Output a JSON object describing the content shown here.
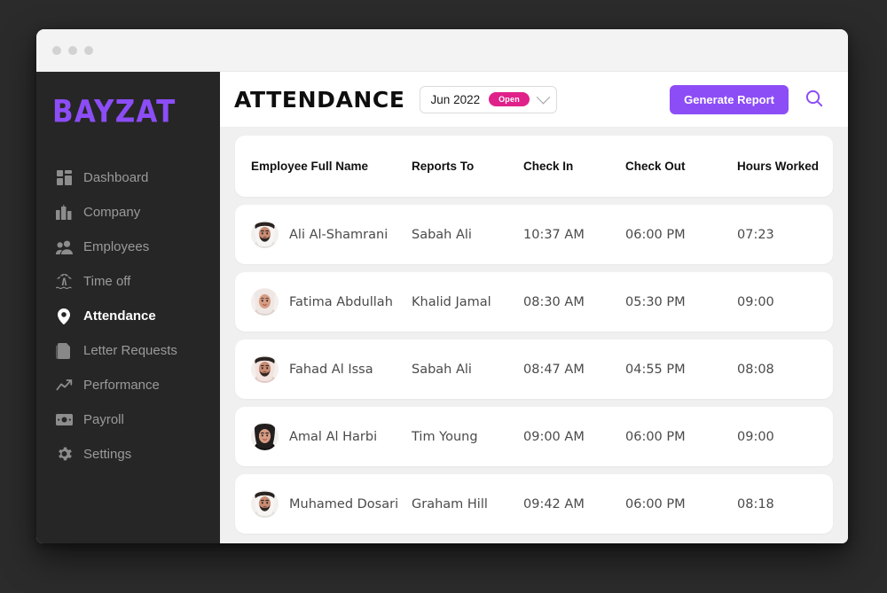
{
  "window": {
    "traffic_lights": [
      "dot",
      "dot",
      "dot"
    ]
  },
  "brand": {
    "logo_text": "BAYZAT",
    "logo_color": "#8c4df7"
  },
  "sidebar": {
    "items": [
      {
        "label": "Dashboard",
        "icon": "grid-icon",
        "active": false
      },
      {
        "label": "Company",
        "icon": "buildings-icon",
        "active": false
      },
      {
        "label": "Employees",
        "icon": "people-icon",
        "active": false
      },
      {
        "label": "Time off",
        "icon": "palm-tree-icon",
        "active": false
      },
      {
        "label": "Attendance",
        "icon": "location-pin-icon",
        "active": true
      },
      {
        "label": "Letter Requests",
        "icon": "documents-icon",
        "active": false
      },
      {
        "label": "Performance",
        "icon": "trend-up-icon",
        "active": false
      },
      {
        "label": "Payroll",
        "icon": "banknote-icon",
        "active": false
      },
      {
        "label": "Settings",
        "icon": "gear-icon",
        "active": false
      }
    ]
  },
  "header": {
    "title": "ATTENDANCE",
    "period": "Jun 2022",
    "period_status": "Open",
    "period_status_color": "#e0218a",
    "generate_report_label": "Generate Report",
    "accent_color": "#8c4df7",
    "search_icon": "search-icon"
  },
  "table": {
    "columns": [
      "Employee Full Name",
      "Reports To",
      "Check In",
      "Check Out",
      "Hours Worked"
    ],
    "rows": [
      {
        "name": "Ali Al-Shamrani",
        "reports_to": "Sabah Ali",
        "check_in": "10:37 AM",
        "check_out": "06:00 PM",
        "hours": "07:23",
        "avatar": "man-keffiyeh-beard"
      },
      {
        "name": "Fatima Abdullah",
        "reports_to": "Khalid Jamal",
        "check_in": "08:30 AM",
        "check_out": "05:30 PM",
        "hours": "09:00",
        "avatar": "woman-hijab-light"
      },
      {
        "name": "Fahad Al Issa",
        "reports_to": "Sabah Ali",
        "check_in": "08:47 AM",
        "check_out": "04:55 PM",
        "hours": "08:08",
        "avatar": "man-red-keffiyeh"
      },
      {
        "name": "Amal Al Harbi",
        "reports_to": "Tim Young",
        "check_in": "09:00 AM",
        "check_out": "06:00 PM",
        "hours": "09:00",
        "avatar": "woman-black-hijab"
      },
      {
        "name": "Muhamed Dosari",
        "reports_to": "Graham Hill",
        "check_in": "09:42 AM",
        "check_out": "06:00 PM",
        "hours": "08:18",
        "avatar": "man-keffiyeh-beard"
      }
    ]
  }
}
